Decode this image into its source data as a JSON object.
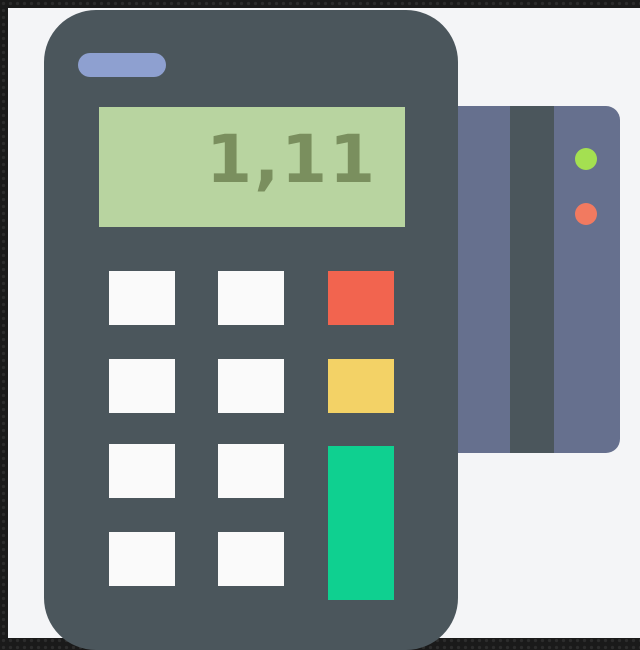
{
  "display": {
    "amount": "1,11"
  },
  "colors": {
    "body": "#4b565c",
    "slot": "#8ea0d0",
    "screen_bg": "#b8d4a0",
    "screen_text": "#7a8f5e",
    "key_white": "#fafafa",
    "key_cancel": "#f2644f",
    "key_clear": "#f3d266",
    "key_enter": "#0fd090",
    "card": "#66708e",
    "card_stripe": "#4b565c",
    "led_green": "#a4e051",
    "led_red": "#f27a60"
  },
  "icons": {
    "terminal": "payment-terminal-icon",
    "card": "credit-card-icon"
  }
}
